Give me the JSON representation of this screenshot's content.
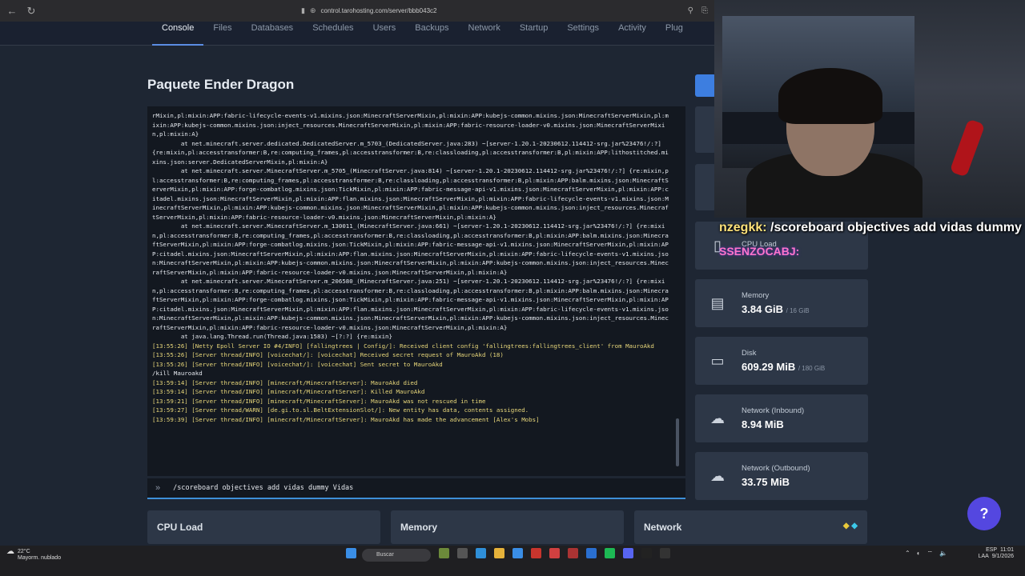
{
  "browser": {
    "url": "control.tarohosting.com/server/bbb043c2"
  },
  "nav_tabs": [
    {
      "label": "Console",
      "active": true
    },
    {
      "label": "Files"
    },
    {
      "label": "Databases"
    },
    {
      "label": "Schedules"
    },
    {
      "label": "Users"
    },
    {
      "label": "Backups"
    },
    {
      "label": "Network"
    },
    {
      "label": "Startup"
    },
    {
      "label": "Settings"
    },
    {
      "label": "Activity"
    },
    {
      "label": "Plug"
    }
  ],
  "page_title": "Paquete Ender Dragon",
  "console_lines": [
    {
      "text": "rMixin,pl:mixin:APP:fabric-lifecycle-events-v1.mixins.json:MinecraftServerMixin,pl:mixin:APP:kubejs-common.mixins.json:MinecraftServerMixin,pl:mixin:APP:kubejs-common.mixins.json:inject_resources.MinecraftServerMixin,pl:mixin:APP:fabric-resource-loader-v0.mixins.json:MinecraftServerMixin,pl:mixin:A}",
      "style": "w"
    },
    {
      "text": "        at net.minecraft.server.dedicated.DedicatedServer.m_5703_(DedicatedServer.java:283) ~[server-1.20.1-20230612.114412-srg.jar%23476!/:?] {re:mixin,pl:accesstransformer:B,re:computing_frames,pl:accesstransformer:B,re:classloading,pl:accesstransformer:B,pl:mixin:APP:lithostitched.mixins.json:server.DedicatedServerMixin,pl:mixin:A}",
      "style": "w"
    },
    {
      "text": "        at net.minecraft.server.MinecraftServer.m_5705_(MinecraftServer.java:814) ~[server-1.20.1-20230612.114412-srg.jar%23476!/:?] {re:mixin,pl:accesstransformer:B,re:computing_frames,pl:accesstransformer:B,re:classloading,pl:accesstransformer:B,pl:mixin:APP:balm.mixins.json:MinecraftServerMixin,pl:mixin:APP:forge-combatlog.mixins.json:TickMixin,pl:mixin:APP:fabric-message-api-v1.mixins.json:MinecraftServerMixin,pl:mixin:APP:citadel.mixins.json:MinecraftServerMixin,pl:mixin:APP:flan.mixins.json:MinecraftServerMixin,pl:mixin:APP:fabric-lifecycle-events-v1.mixins.json:MinecraftServerMixin,pl:mixin:APP:kubejs-common.mixins.json:MinecraftServerMixin,pl:mixin:APP:kubejs-common.mixins.json:inject_resources.MinecraftServerMixin,pl:mixin:APP:fabric-resource-loader-v0.mixins.json:MinecraftServerMixin,pl:mixin:A}",
      "style": "w"
    },
    {
      "text": "        at net.minecraft.server.MinecraftServer.m_130011_(MinecraftServer.java:661) ~[server-1.20.1-20230612.114412-srg.jar%23476!/:?] {re:mixin,pl:accesstransformer:B,re:computing_frames,pl:accesstransformer:B,re:classloading,pl:accesstransformer:B,pl:mixin:APP:balm.mixins.json:MinecraftServerMixin,pl:mixin:APP:forge-combatlog.mixins.json:TickMixin,pl:mixin:APP:fabric-message-api-v1.mixins.json:MinecraftServerMixin,pl:mixin:APP:citadel.mixins.json:MinecraftServerMixin,pl:mixin:APP:flan.mixins.json:MinecraftServerMixin,pl:mixin:APP:fabric-lifecycle-events-v1.mixins.json:MinecraftServerMixin,pl:mixin:APP:kubejs-common.mixins.json:MinecraftServerMixin,pl:mixin:APP:kubejs-common.mixins.json:inject_resources.MinecraftServerMixin,pl:mixin:APP:fabric-resource-loader-v0.mixins.json:MinecraftServerMixin,pl:mixin:A}",
      "style": "w"
    },
    {
      "text": "        at net.minecraft.server.MinecraftServer.m_206580_(MinecraftServer.java:251) ~[server-1.20.1-20230612.114412-srg.jar%23476!/:?] {re:mixin,pl:accesstransformer:B,re:computing_frames,pl:accesstransformer:B,re:classloading,pl:accesstransformer:B,pl:mixin:APP:balm.mixins.json:MinecraftServerMixin,pl:mixin:APP:forge-combatlog.mixins.json:TickMixin,pl:mixin:APP:fabric-message-api-v1.mixins.json:MinecraftServerMixin,pl:mixin:APP:citadel.mixins.json:MinecraftServerMixin,pl:mixin:APP:flan.mixins.json:MinecraftServerMixin,pl:mixin:APP:fabric-lifecycle-events-v1.mixins.json:MinecraftServerMixin,pl:mixin:APP:kubejs-common.mixins.json:MinecraftServerMixin,pl:mixin:APP:kubejs-common.mixins.json:inject_resources.MinecraftServerMixin,pl:mixin:APP:fabric-resource-loader-v0.mixins.json:MinecraftServerMixin,pl:mixin:A}",
      "style": "w"
    },
    {
      "text": "        at java.lang.Thread.run(Thread.java:1583) ~[?:?] {re:mixin}",
      "style": "w"
    },
    {
      "text": "[13:55:26] [Netty Epoll Server IO #4/INFO] [fallingtrees | Config/]: Received client config 'fallingtrees:fallingtrees_client' from MauroAkd",
      "style": "y"
    },
    {
      "text": "[13:55:26] [Server thread/INFO] [voicechat/]: [voicechat] Received secret request of MauroAkd (18)",
      "style": "y"
    },
    {
      "text": "[13:55:26] [Server thread/INFO] [voicechat/]: [voicechat] Sent secret to MauroAkd",
      "style": "y"
    },
    {
      "text": "/kill Mauroakd",
      "style": "w"
    },
    {
      "text": "[13:59:14] [Server thread/INFO] [minecraft/MinecraftServer]: MauroAkd died",
      "style": "y"
    },
    {
      "text": "[13:59:14] [Server thread/INFO] [minecraft/MinecraftServer]: Killed MauroAkd",
      "style": "y"
    },
    {
      "text": "[13:59:21] [Server thread/INFO] [minecraft/MinecraftServer]: MauroAkd was not rescued in time",
      "style": "y"
    },
    {
      "text": "[13:59:27] [Server thread/WARN] [de.gi.to.sl.BeltExtensionSlot/]: New entity has data, contents assigned.",
      "style": "y"
    },
    {
      "text": "[13:59:39] [Server thread/INFO] [minecraft/MinecraftServer]: MauroAkd has made the advancement [Alex's Mobs]",
      "style": "y"
    }
  ],
  "command_input": {
    "prompt": "»",
    "value": "/scoreboard objectives add vidas dummy Vidas"
  },
  "side_stats": [
    {
      "label": "CPU Load",
      "value": "",
      "sub": "",
      "icon": "cpu-icon"
    },
    {
      "label": "Memory",
      "value": "3.84 GiB",
      "sub": "/ 16 GiB",
      "icon": "memory-icon"
    },
    {
      "label": "Disk",
      "value": "609.29 MiB",
      "sub": "/ 180 GiB",
      "icon": "disk-icon"
    },
    {
      "label": "Network (Inbound)",
      "value": "8.94 MiB",
      "sub": "",
      "icon": "cloud-download-icon"
    },
    {
      "label": "Network (Outbound)",
      "value": "33.75 MiB",
      "sub": "",
      "icon": "cloud-upload-icon"
    }
  ],
  "bottom_cards": [
    {
      "label": "CPU Load"
    },
    {
      "label": "Memory"
    },
    {
      "label": "Network"
    }
  ],
  "overlay_chat": {
    "user": "nzegkk:",
    "message": "/scoreboard objectives add vidas dummy",
    "badge_name": "SSENZOCABJ:"
  },
  "help_button": "?",
  "taskbar": {
    "weather_temp": "22°C",
    "weather_desc": "Mayorm. nublado",
    "search_placeholder": "Buscar",
    "lang": "ESP",
    "lang_sub": "LAA",
    "time": "11:01",
    "date": "9/1/2026"
  },
  "colors": {
    "accent": "#3d8fd8",
    "help_button": "#5447e0",
    "log_info": "#e8d77a"
  }
}
